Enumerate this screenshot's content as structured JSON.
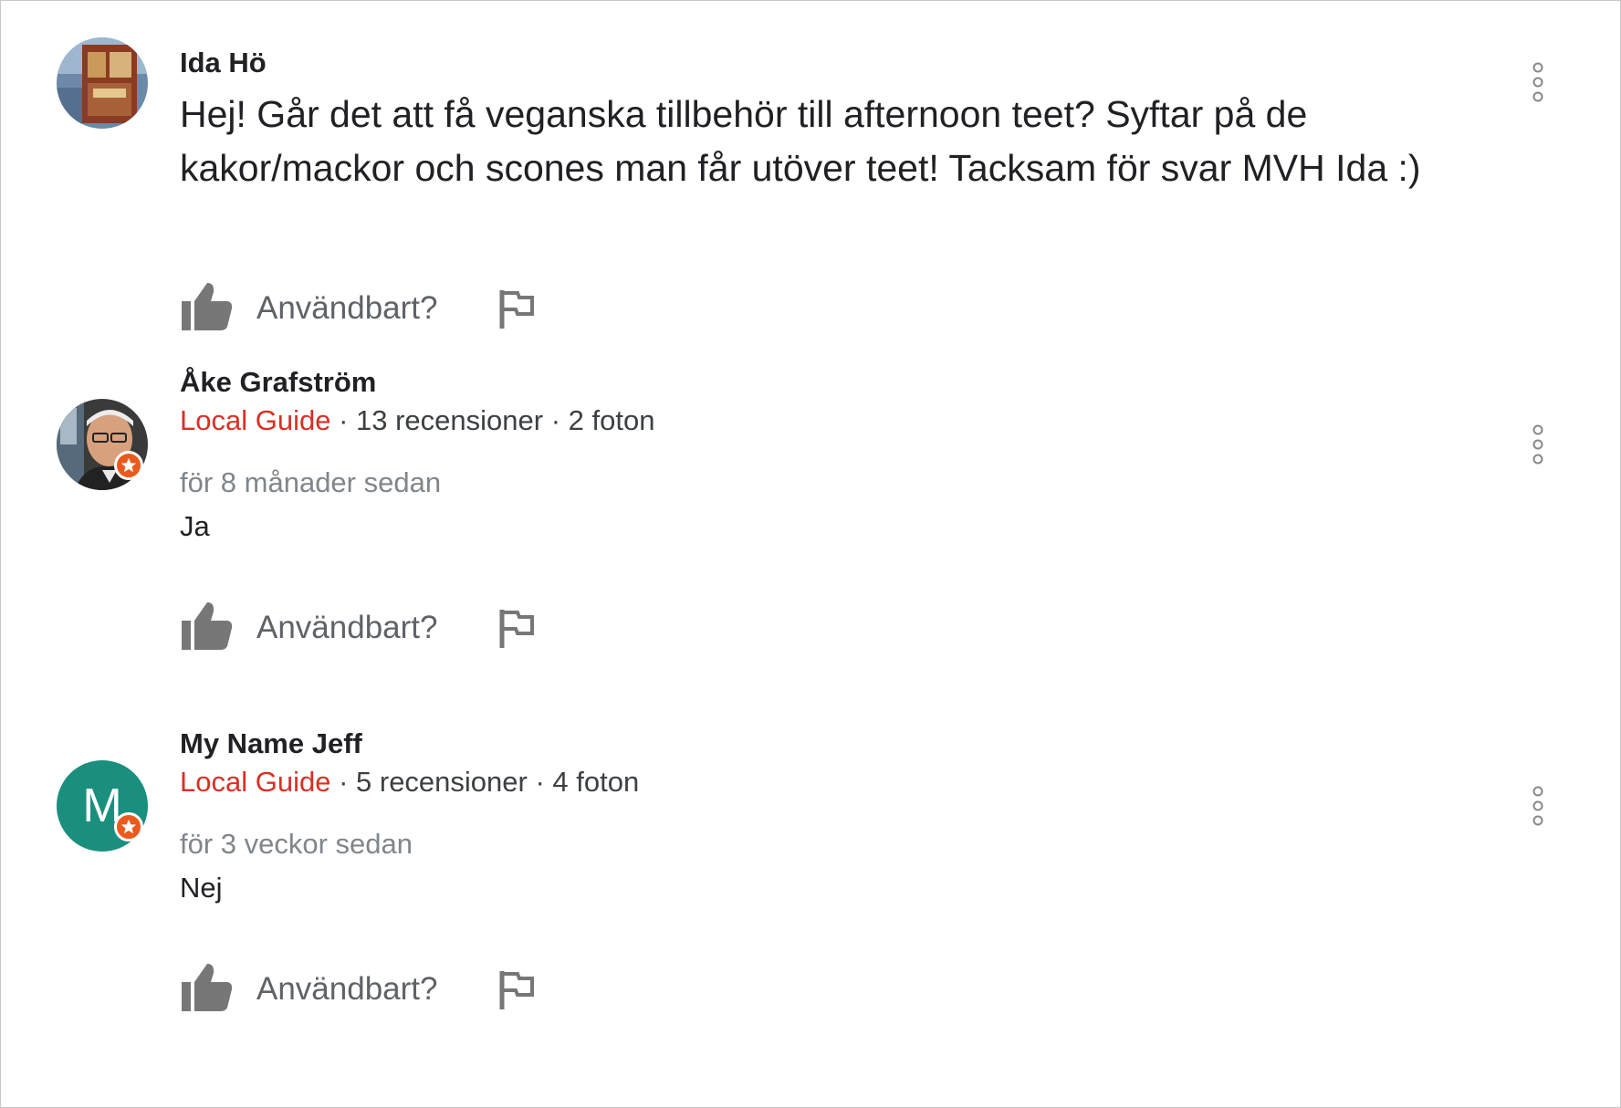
{
  "posts": [
    {
      "author": "Ida Hö",
      "text": "Hej! Går det att få veganska tillbehör till afternoon teet? Syftar på de kakor/mackor och scones man får utöver teet! Tacksam för svar MVH Ida :)",
      "helpful_label": "Användbart?",
      "icons": {
        "helpful": "thumbs-up-icon",
        "report": "flag-icon",
        "more": "more-vert-icon"
      }
    },
    {
      "author": "Åke Grafström",
      "badge": "Local Guide",
      "stats": "· 13 recensioner · 2 foton",
      "time": "för 8 månader sedan",
      "text": "Ja",
      "helpful_label": "Användbart?"
    },
    {
      "author": "My Name Jeff",
      "avatar_letter": "M",
      "badge": "Local Guide",
      "stats": "· 5 recensioner · 4 foton",
      "time": "för 3 veckor sedan",
      "text": "Nej",
      "helpful_label": "Användbart?"
    }
  ],
  "colors": {
    "local_guide": "#d93025",
    "badge": "#ea5a1c",
    "avatar_bg": "#1a8f7e",
    "icon": "#777777"
  }
}
